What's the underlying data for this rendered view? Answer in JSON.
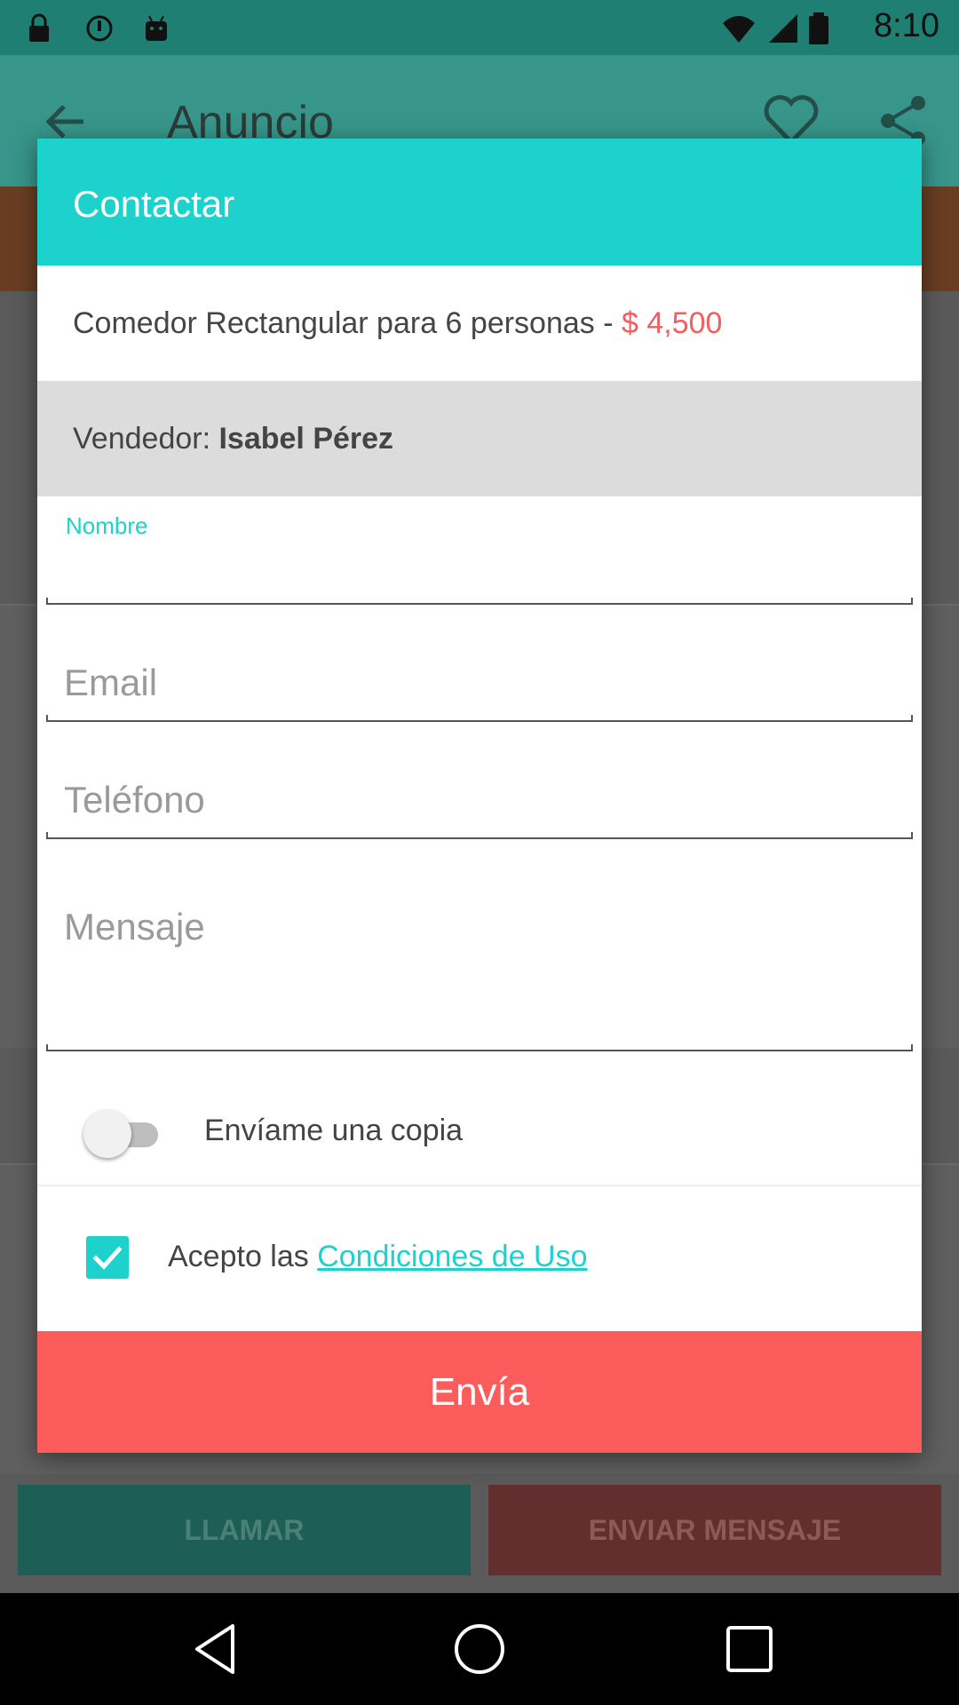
{
  "status_bar": {
    "time": "8:10",
    "icons": [
      "lock-icon",
      "sync-icon",
      "android-icon",
      "wifi-icon",
      "signal-icon",
      "battery-icon"
    ]
  },
  "app_bar": {
    "title": "Anuncio",
    "icons": [
      "back-arrow-icon",
      "heart-icon",
      "share-icon"
    ]
  },
  "bottom_actions": {
    "call_label": "LLAMAR",
    "message_label": "ENVIAR MENSAJE"
  },
  "dialog": {
    "title": "Contactar",
    "product": {
      "name": "Comedor Rectangular para 6 personas - ",
      "price": "$ 4,500"
    },
    "seller": {
      "label": "Vendedor: ",
      "name": "Isabel Pérez"
    },
    "fields": {
      "name_label": "Nombre",
      "name_value": "",
      "email_placeholder": "Email",
      "phone_placeholder": "Teléfono",
      "message_placeholder": "Mensaje"
    },
    "copy_toggle": {
      "label": "Envíame una copia",
      "on": false
    },
    "terms": {
      "prefix": "Acepto las ",
      "link": "Condiciones de Uso",
      "checked": true
    },
    "send_label": "Envía"
  },
  "colors": {
    "accent": "#1dd1cc",
    "send": "#fd5c5c",
    "price": "#f45d5d"
  }
}
